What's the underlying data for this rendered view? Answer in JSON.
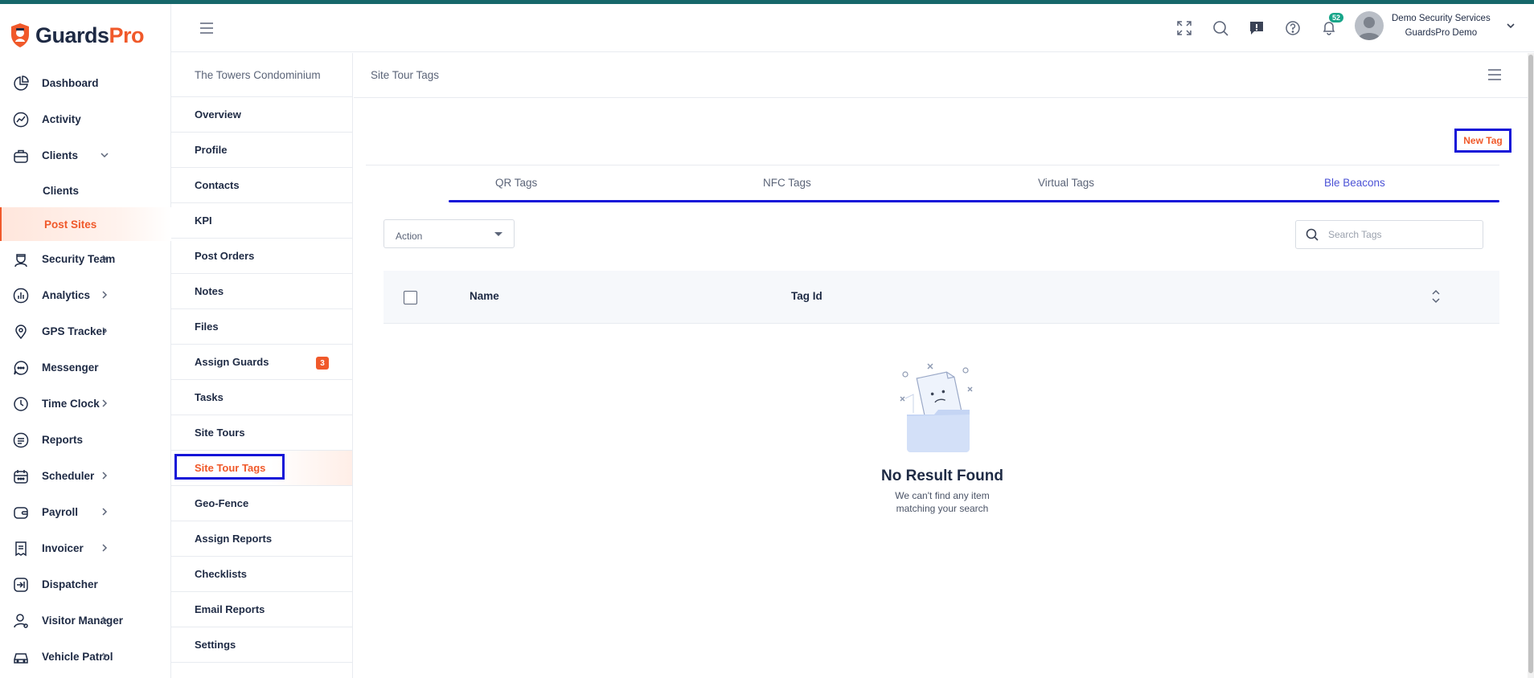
{
  "brand": {
    "name_a": "Guards",
    "name_b": "Pro",
    "accent": "#f0592a",
    "top_bar": "#16676a"
  },
  "sidebar": {
    "items": [
      {
        "label": "Dashboard",
        "icon": "dashboard-icon",
        "chevron": false
      },
      {
        "label": "Activity",
        "icon": "activity-icon",
        "chevron": false
      },
      {
        "label": "Clients",
        "icon": "clients-icon",
        "chevron": "down"
      },
      {
        "label": "Clients",
        "icon": "",
        "sub": true
      },
      {
        "label": "Post Sites",
        "icon": "",
        "sub": true,
        "active": true
      },
      {
        "label": "Security Team",
        "icon": "security-team-icon",
        "chevron": "right"
      },
      {
        "label": "Analytics",
        "icon": "analytics-icon",
        "chevron": "right"
      },
      {
        "label": "GPS Tracker",
        "icon": "gps-icon",
        "chevron": "right"
      },
      {
        "label": "Messenger",
        "icon": "messenger-icon",
        "chevron": false
      },
      {
        "label": "Time Clock",
        "icon": "clock-icon",
        "chevron": "right"
      },
      {
        "label": "Reports",
        "icon": "reports-icon",
        "chevron": false
      },
      {
        "label": "Scheduler",
        "icon": "calendar-icon",
        "chevron": "right"
      },
      {
        "label": "Payroll",
        "icon": "wallet-icon",
        "chevron": "right"
      },
      {
        "label": "Invoicer",
        "icon": "invoice-icon",
        "chevron": "right"
      },
      {
        "label": "Dispatcher",
        "icon": "dispatch-icon",
        "chevron": false
      },
      {
        "label": "Visitor Manager",
        "icon": "visitor-icon",
        "chevron": "right"
      },
      {
        "label": "Vehicle Patrol",
        "icon": "car-icon",
        "chevron": "right"
      }
    ]
  },
  "header": {
    "notification_count": "52",
    "user_company": "Demo Security Services",
    "user_name": "GuardsPro Demo"
  },
  "subnav": {
    "title": "The Towers Condominium",
    "items": [
      {
        "label": "Overview"
      },
      {
        "label": "Profile"
      },
      {
        "label": "Contacts"
      },
      {
        "label": "KPI"
      },
      {
        "label": "Post Orders"
      },
      {
        "label": "Notes"
      },
      {
        "label": "Files"
      },
      {
        "label": "Assign Guards",
        "count": "3"
      },
      {
        "label": "Tasks"
      },
      {
        "label": "Site Tours"
      },
      {
        "label": "Site Tour Tags",
        "active": true
      },
      {
        "label": "Geo-Fence"
      },
      {
        "label": "Assign Reports"
      },
      {
        "label": "Checklists"
      },
      {
        "label": "Email Reports"
      },
      {
        "label": "Settings"
      }
    ]
  },
  "main": {
    "title": "Site Tour Tags",
    "new_tag_label": "New Tag",
    "tabs": [
      "QR Tags",
      "NFC Tags",
      "Virtual Tags",
      "Ble Beacons"
    ],
    "active_tab": "Ble Beacons",
    "action_label": "Action",
    "search_placeholder": "Search Tags",
    "columns": {
      "name": "Name",
      "tag_id": "Tag Id"
    },
    "empty_title": "No Result Found",
    "empty_line1": "We can't find any item",
    "empty_line2": "matching your search"
  }
}
